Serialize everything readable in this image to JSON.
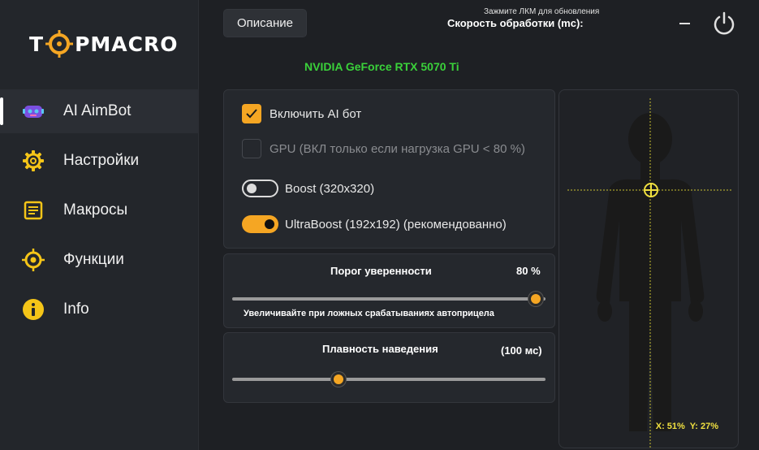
{
  "app": {
    "logo_left": "T",
    "logo_right": "PMACRO"
  },
  "sidebar": {
    "items": [
      {
        "label": "AI AimBot",
        "icon": "robot-icon",
        "active": true
      },
      {
        "label": "Настройки",
        "icon": "gear-icon",
        "active": false
      },
      {
        "label": "Макросы",
        "icon": "document-icon",
        "active": false
      },
      {
        "label": "Функции",
        "icon": "crosshair-icon",
        "active": false
      },
      {
        "label": "Info",
        "icon": "info-icon",
        "active": false
      }
    ]
  },
  "header": {
    "description_button": "Описание",
    "speed_hint": "Зажмите ЛКМ для обновления",
    "speed_label": "Скорость обработки (mc):",
    "gpu_name": "NVIDIA GeForce RTX 5070 Ti"
  },
  "options": {
    "enable_ai": {
      "label": "Включить AI бот",
      "checked": true
    },
    "gpu": {
      "label": "GPU (ВКЛ только если нагрузка GPU < 80 %)",
      "checked": false
    },
    "boost": {
      "label": "Boost (320x320)",
      "on": false
    },
    "ultraboost": {
      "label": "UltraBoost (192x192) (рекомендованно)",
      "on": true
    }
  },
  "confidence": {
    "title": "Порог уверенности",
    "value_text": "80 %",
    "value": 0.97,
    "note": "Увеличивайте при ложных срабатываниях автоприцела"
  },
  "smoothness": {
    "title": "Плавность наведения",
    "value_text": "(100 мс)",
    "value": 0.34
  },
  "target": {
    "x_text": "X: 51%",
    "y_text": "Y: 27%"
  },
  "colors": {
    "accent": "#f5a623",
    "gpu_text": "#3ad13a",
    "coords_text": "#f0e040"
  }
}
